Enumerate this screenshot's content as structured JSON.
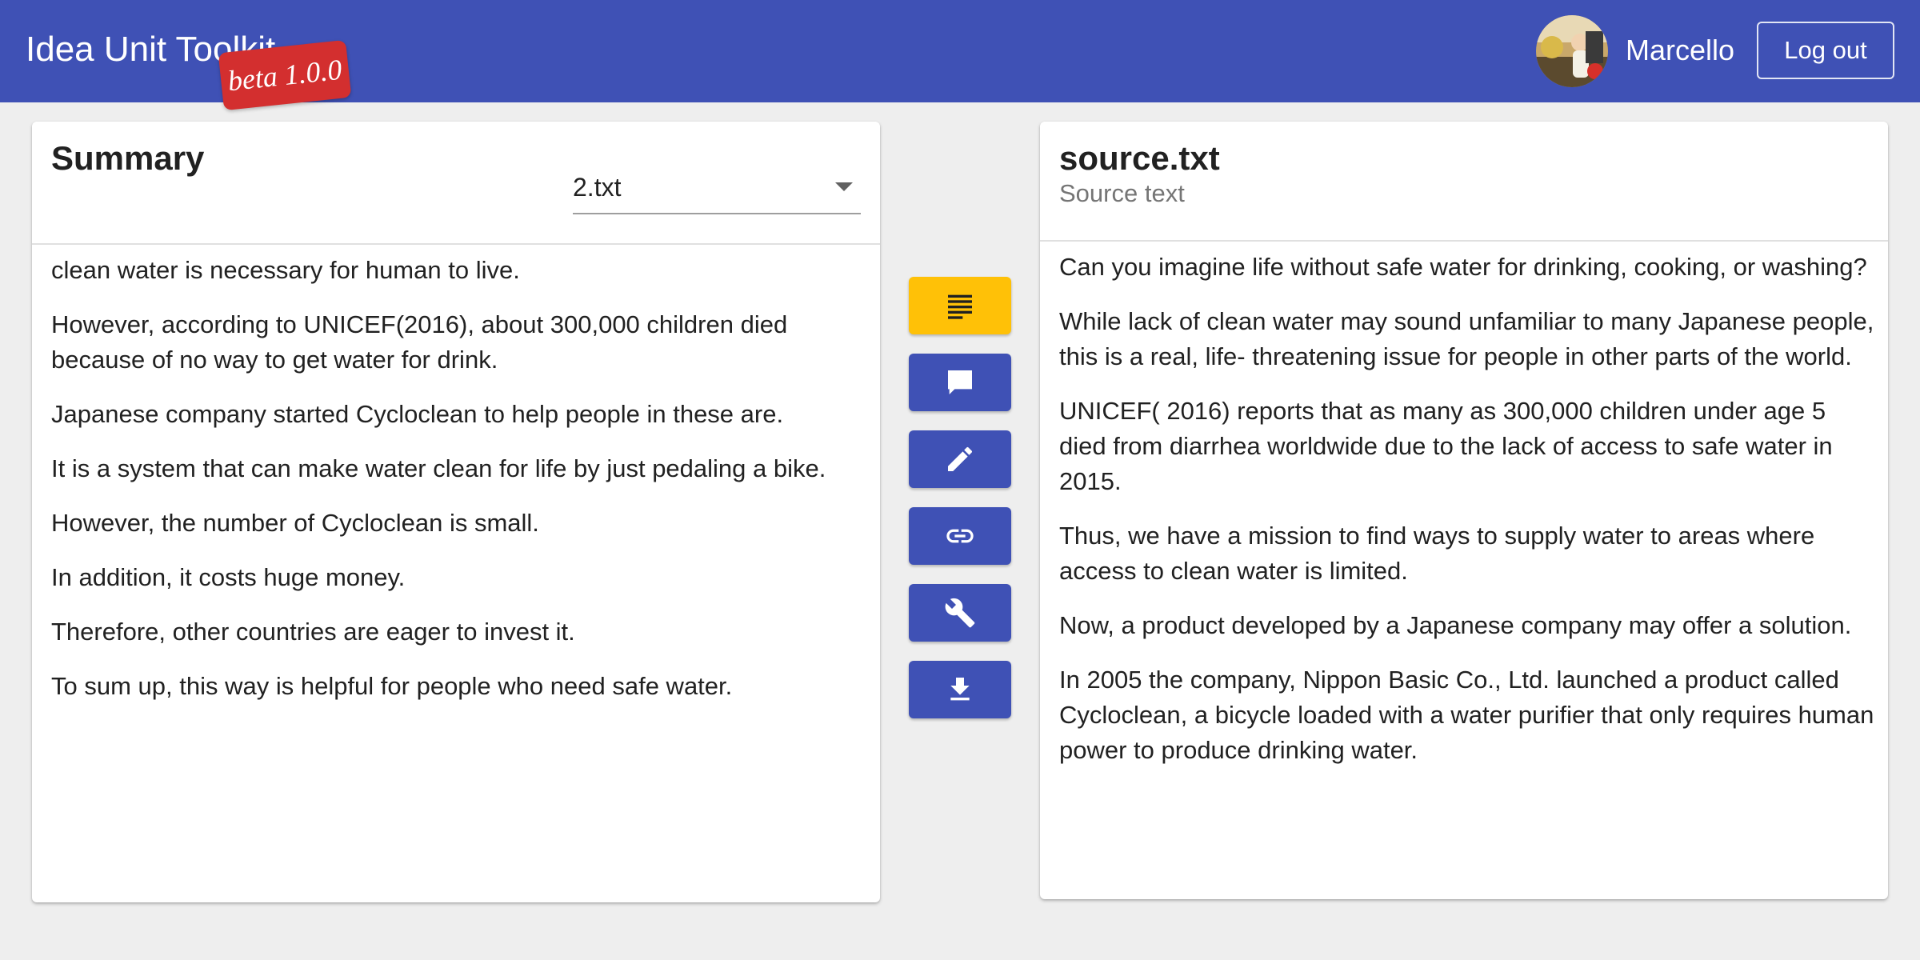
{
  "header": {
    "app_title": "Idea Unit Toolkit",
    "version_badge": "beta 1.0.0",
    "username": "Marcello",
    "logout_label": "Log out",
    "colors": {
      "bar": "#3f51b5",
      "badge": "#d32f2f"
    }
  },
  "summary_panel": {
    "title": "Summary",
    "file_select": {
      "value": "2.txt"
    },
    "paragraphs": [
      "clean water is necessary for human to live.",
      "However, according to UNICEF(2016), about 300,000 children died because of no way to get water for drink.",
      "Japanese company started Cycloclean to help people in these are.",
      "It is a system that can make water clean for life by just pedaling a bike.",
      "However, the number of Cycloclean is small.",
      "In addition, it costs huge money.",
      "Therefore, other countries are eager to invest it.",
      "To sum up, this way is helpful for people who need safe water."
    ]
  },
  "toolbar": {
    "buttons": [
      {
        "icon": "text-lines-icon",
        "active": true
      },
      {
        "icon": "comment-icon",
        "active": false
      },
      {
        "icon": "pencil-icon",
        "active": false
      },
      {
        "icon": "link-icon",
        "active": false
      },
      {
        "icon": "wrench-icon",
        "active": false
      },
      {
        "icon": "download-icon",
        "active": false
      }
    ],
    "colors": {
      "active": "#ffc107",
      "default": "#3f51b5"
    }
  },
  "source_panel": {
    "title": "source.txt",
    "subtitle": "Source text",
    "paragraphs": [
      "Can you imagine life without safe water for drinking, cooking, or washing?",
      "While lack of clean water may sound unfamiliar to many Japanese people, this is a real, life- threatening issue for people in other parts of the world.",
      "UNICEF( 2016) reports that as many as 300,000 children under age 5 died from diarrhea worldwide due to the lack of access to safe water in 2015.",
      "Thus, we have a mission to find ways to supply water to areas where access to clean water is limited.",
      "Now, a product developed by a Japanese company may offer a solution.",
      "In 2005 the company, Nippon Basic Co., Ltd. launched a product called Cycloclean, a bicycle loaded with a water purifier that only requires human power to produce drinking water."
    ]
  }
}
